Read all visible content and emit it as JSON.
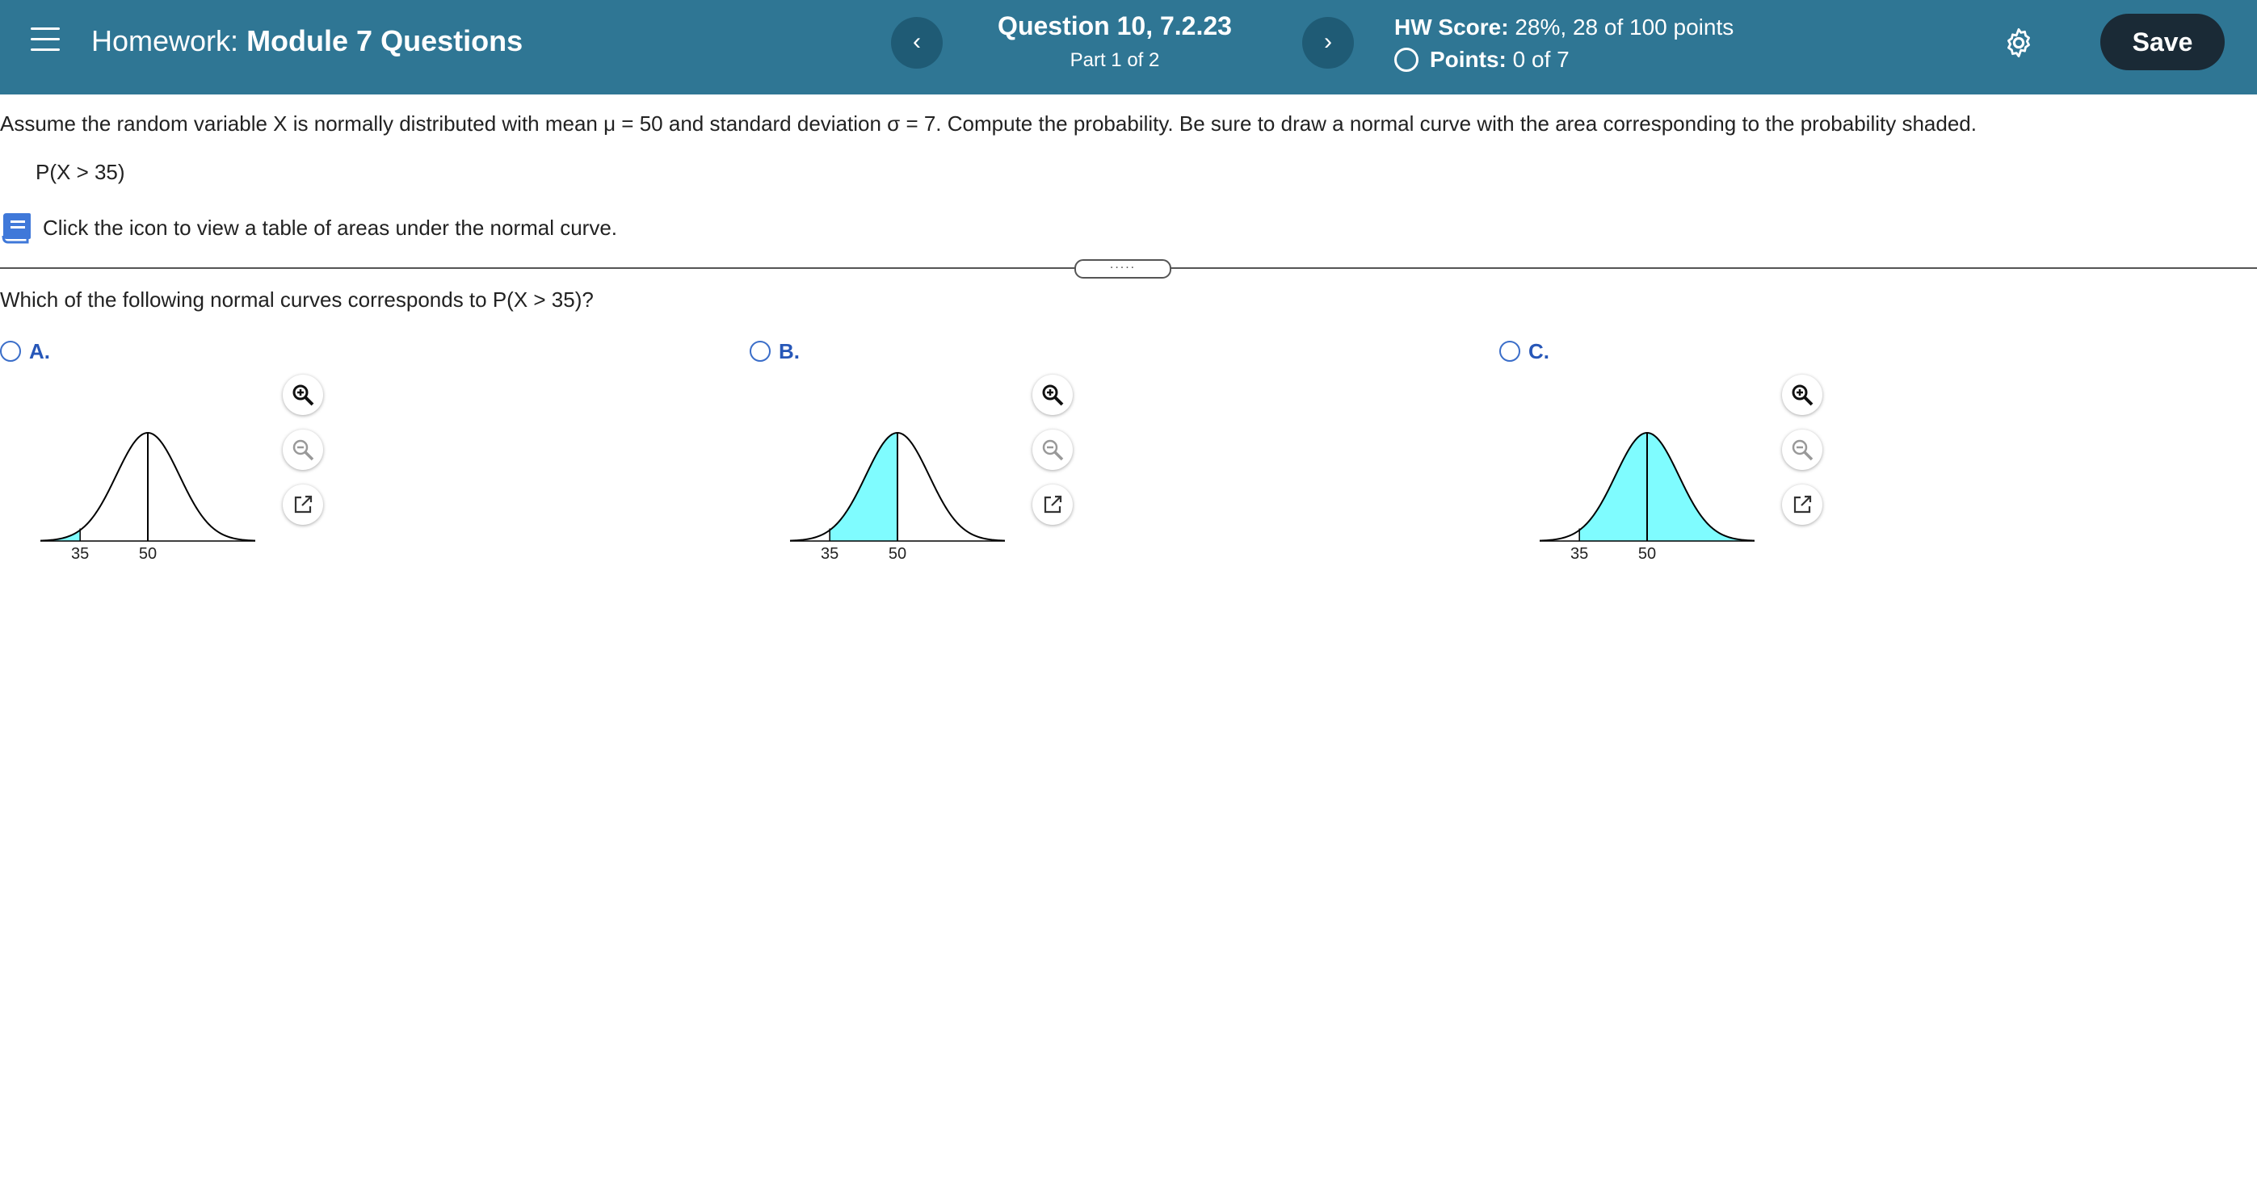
{
  "header": {
    "menu_icon": "hamburger-menu-icon",
    "homework_prefix": "Homework:",
    "homework_name": "Module 7 Questions",
    "prev_label": "‹",
    "next_label": "›",
    "question_title": "Question 10, 7.2.23",
    "question_part": "Part 1 of 2",
    "hw_score_label": "HW Score:",
    "hw_score_value": "28%, 28 of 100 points",
    "points_label": "Points:",
    "points_value": "0 of 7",
    "settings_icon": "gear-icon",
    "save_label": "Save"
  },
  "question": {
    "text": "Assume the random variable X is normally distributed with mean μ = 50 and standard deviation σ = 7. Compute the probability. Be sure to draw a normal curve with the area corresponding to the probability shaded.",
    "probability": "P(X > 35)",
    "hint_icon": "book-icon",
    "hint": "Click the icon to view a table of areas under the normal curve.",
    "divider_handle": "....."
  },
  "part": {
    "prompt": "Which of the following normal curves corresponds to P(X > 35)?",
    "options": [
      {
        "label": "A.",
        "shaded": "left tail: X < 35"
      },
      {
        "label": "B.",
        "shaded": "between 35 and 50"
      },
      {
        "label": "C.",
        "shaded": "right of 35: X > 35"
      }
    ],
    "tool_icons": [
      "zoom-in-icon",
      "zoom-out-icon",
      "open-external-icon"
    ]
  },
  "chart_data": [
    {
      "type": "area",
      "mean": 50,
      "sd": 7,
      "ticks": [
        "35",
        "50"
      ],
      "shaded_from": 29,
      "shaded_to": 35,
      "fill": "#7ffcff"
    },
    {
      "type": "area",
      "mean": 50,
      "sd": 7,
      "ticks": [
        "35",
        "50"
      ],
      "shaded_from": 35,
      "shaded_to": 50,
      "fill": "#7ffcff"
    },
    {
      "type": "area",
      "mean": 50,
      "sd": 7,
      "ticks": [
        "35",
        "50"
      ],
      "shaded_from": 35,
      "shaded_to": 71,
      "fill": "#7ffcff"
    }
  ],
  "colors": {
    "header_bg": "#2f7694",
    "save_bg": "#1a2a36",
    "option_blue": "#2757b8",
    "shade": "#7ffcff"
  }
}
